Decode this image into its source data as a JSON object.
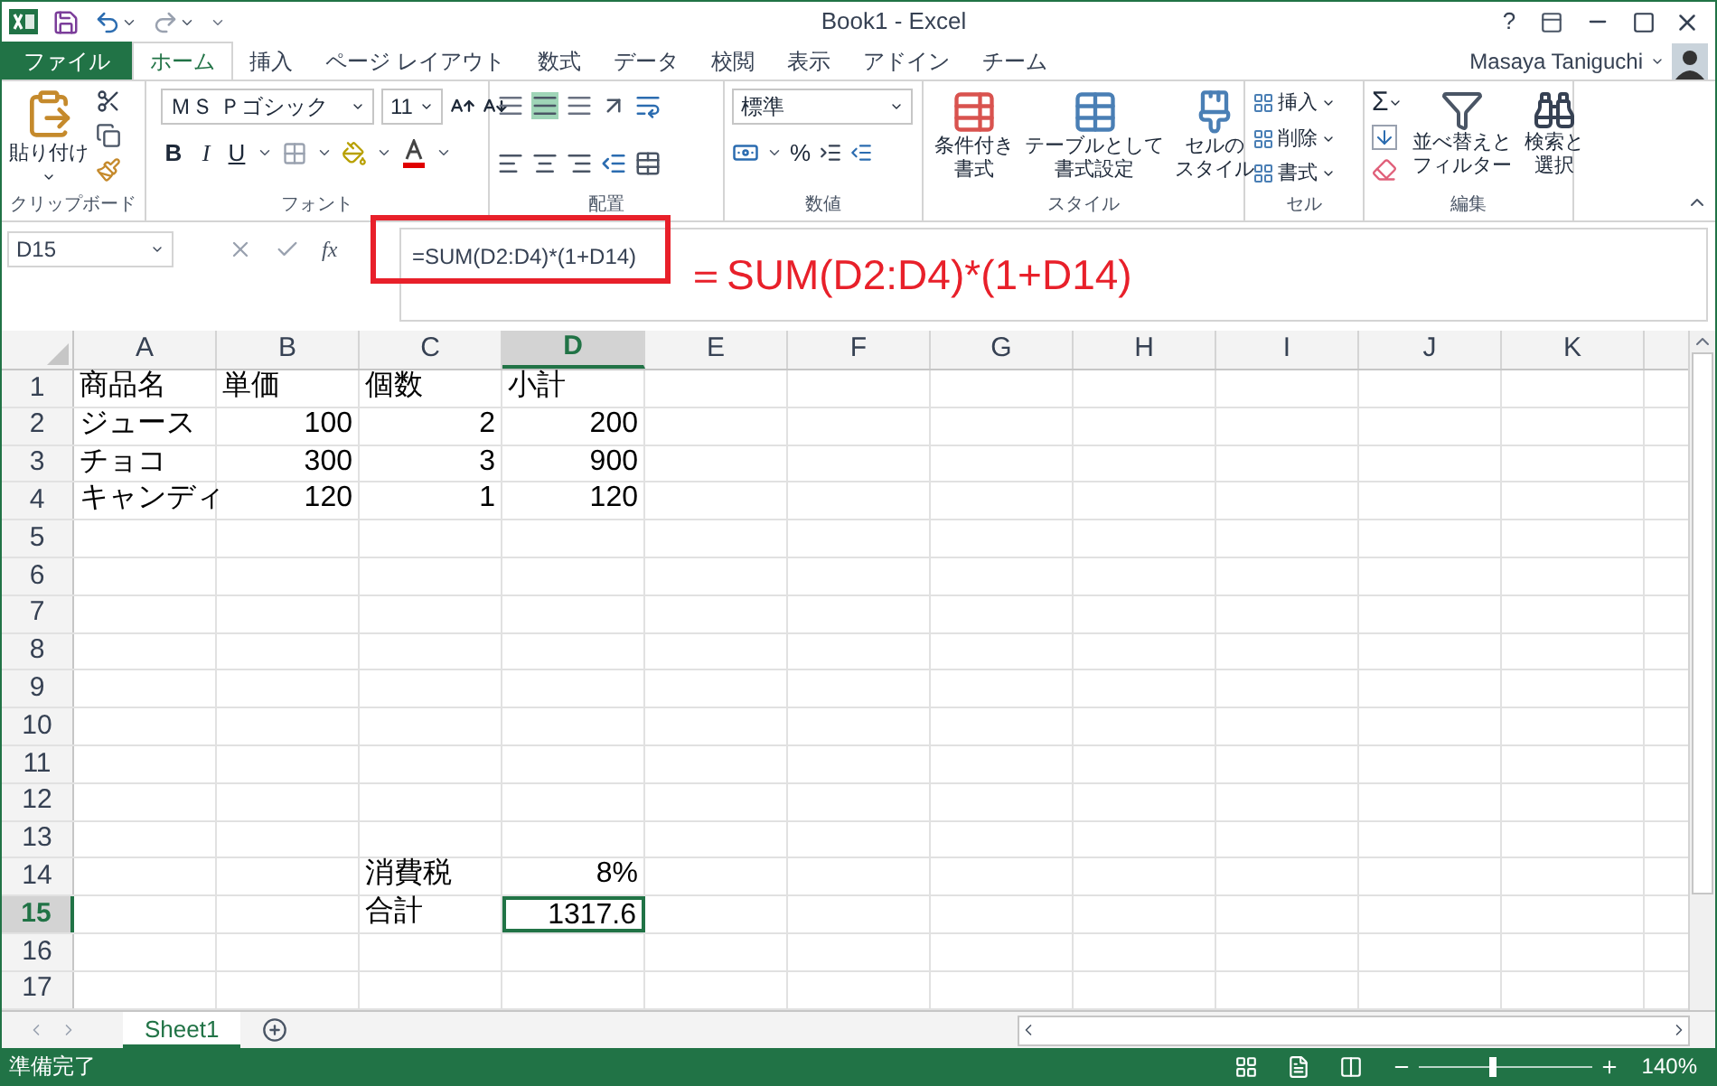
{
  "title_bar": {
    "title": "Book1 - Excel",
    "help": "?"
  },
  "tabs": [
    {
      "label": "ファイル",
      "kind": "file",
      "selected": false
    },
    {
      "label": "ホーム",
      "kind": "tab",
      "selected": true
    },
    {
      "label": "挿入",
      "kind": "tab",
      "selected": false
    },
    {
      "label": "ページ レイアウト",
      "kind": "tab",
      "selected": false
    },
    {
      "label": "数式",
      "kind": "tab",
      "selected": false
    },
    {
      "label": "データ",
      "kind": "tab",
      "selected": false
    },
    {
      "label": "校閲",
      "kind": "tab",
      "selected": false
    },
    {
      "label": "表示",
      "kind": "tab",
      "selected": false
    },
    {
      "label": "アドイン",
      "kind": "tab",
      "selected": false
    },
    {
      "label": "チーム",
      "kind": "tab",
      "selected": false
    }
  ],
  "user": "Masaya Taniguchi",
  "ribbon": {
    "clipboard": {
      "label": "クリップボード",
      "paste": "貼り付け"
    },
    "font": {
      "label": "フォント",
      "font_name": "ＭＳ Ｐゴシック",
      "font_size": "11",
      "bold": "B",
      "italic": "I",
      "underline": "U"
    },
    "alignment": {
      "label": "配置"
    },
    "number": {
      "label": "数値",
      "format": "標準",
      "percent": "%"
    },
    "styles": {
      "label": "スタイル",
      "buttons": [
        {
          "lines": [
            "条件付き",
            "書式"
          ]
        },
        {
          "lines": [
            "テーブルとして",
            "書式設定"
          ]
        },
        {
          "lines": [
            "セルの",
            "スタイル"
          ]
        }
      ]
    },
    "cells": {
      "label": "セル",
      "buttons": [
        "挿入",
        "削除",
        "書式"
      ]
    },
    "editing": {
      "label": "編集",
      "sum": "Σ",
      "buttons": [
        {
          "lines": [
            "並べ替えと",
            "フィルター"
          ]
        },
        {
          "lines": [
            "検索と",
            "選択"
          ]
        }
      ]
    }
  },
  "formula_bar": {
    "name_box": "D15",
    "fx": "fx",
    "formula": "=SUM(D2:D4)*(1+D14)"
  },
  "annotation": "＝SUM(D2:D4)*(1+D14)",
  "columns": [
    {
      "label": "A",
      "selected": false
    },
    {
      "label": "B",
      "selected": false
    },
    {
      "label": "C",
      "selected": false
    },
    {
      "label": "D",
      "selected": true
    },
    {
      "label": "E",
      "selected": false
    },
    {
      "label": "F",
      "selected": false
    },
    {
      "label": "G",
      "selected": false
    },
    {
      "label": "H",
      "selected": false
    },
    {
      "label": "I",
      "selected": false
    },
    {
      "label": "J",
      "selected": false
    },
    {
      "label": "K",
      "selected": false
    }
  ],
  "rows": [
    {
      "header": "1",
      "selected": false,
      "cells": [
        {
          "text": "商品名",
          "kind": "text",
          "selected": false
        },
        {
          "text": "単価",
          "kind": "text",
          "selected": false
        },
        {
          "text": "個数",
          "kind": "text",
          "selected": false
        },
        {
          "text": "小計",
          "kind": "text",
          "selected": false
        }
      ]
    },
    {
      "header": "2",
      "selected": false,
      "cells": [
        {
          "text": "ジュース",
          "kind": "text",
          "selected": false
        },
        {
          "text": "100",
          "kind": "number",
          "selected": false
        },
        {
          "text": "2",
          "kind": "number",
          "selected": false
        },
        {
          "text": "200",
          "kind": "number",
          "selected": false
        }
      ]
    },
    {
      "header": "3",
      "selected": false,
      "cells": [
        {
          "text": "チョコ",
          "kind": "text",
          "selected": false
        },
        {
          "text": "300",
          "kind": "number",
          "selected": false
        },
        {
          "text": "3",
          "kind": "number",
          "selected": false
        },
        {
          "text": "900",
          "kind": "number",
          "selected": false
        }
      ]
    },
    {
      "header": "4",
      "selected": false,
      "cells": [
        {
          "text": "キャンディ",
          "kind": "text",
          "selected": false
        },
        {
          "text": "120",
          "kind": "number",
          "selected": false
        },
        {
          "text": "1",
          "kind": "number",
          "selected": false
        },
        {
          "text": "120",
          "kind": "number",
          "selected": false
        }
      ]
    },
    {
      "header": "5",
      "selected": false
    },
    {
      "header": "6",
      "selected": false
    },
    {
      "header": "7",
      "selected": false
    },
    {
      "header": "8",
      "selected": false
    },
    {
      "header": "9",
      "selected": false
    },
    {
      "header": "10",
      "selected": false
    },
    {
      "header": "11",
      "selected": false
    },
    {
      "header": "12",
      "selected": false
    },
    {
      "header": "13",
      "selected": false
    },
    {
      "header": "14",
      "selected": false,
      "cells": [
        null,
        null,
        {
          "text": "消費税",
          "kind": "text",
          "selected": false
        },
        {
          "text": "8%",
          "kind": "number",
          "selected": false
        }
      ]
    },
    {
      "header": "15",
      "selected": true,
      "cells": [
        null,
        null,
        {
          "text": "合計",
          "kind": "text",
          "selected": false
        },
        {
          "text": "1317.6",
          "kind": "number",
          "selected": true
        }
      ]
    },
    {
      "header": "16",
      "selected": false
    },
    {
      "header": "17",
      "selected": false
    }
  ],
  "sheets": [
    {
      "label": "Sheet1",
      "selected": true
    }
  ],
  "status_bar": {
    "status": "準備完了",
    "zoom": "140%",
    "zoom_slider": {
      "level": 0.42
    }
  }
}
